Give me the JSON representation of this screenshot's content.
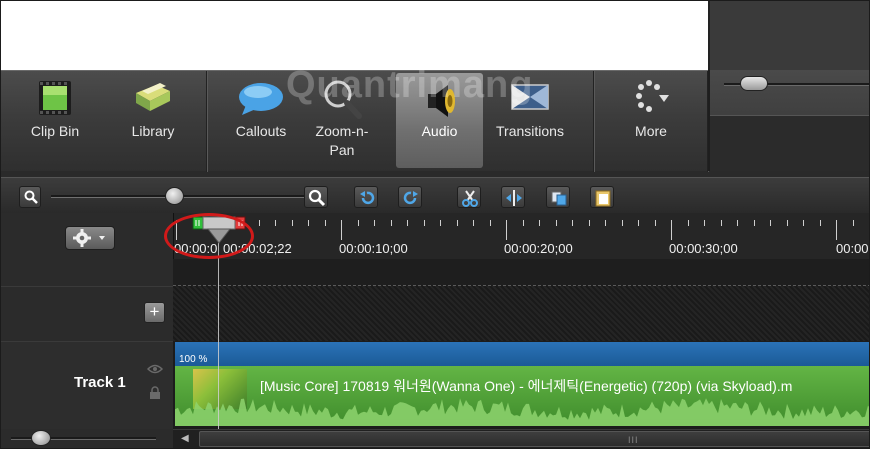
{
  "toolbar": {
    "tools": [
      {
        "label": "Clip Bin",
        "icon": "clip-bin-icon"
      },
      {
        "label": "Library",
        "icon": "library-icon"
      },
      {
        "label": "Callouts",
        "icon": "callouts-icon"
      },
      {
        "label": "Zoom-n-Pan",
        "icon": "zoom-n-pan-icon"
      },
      {
        "label": "Audio",
        "icon": "audio-icon",
        "active": true
      },
      {
        "label": "Transitions",
        "icon": "transitions-icon"
      },
      {
        "label": "More",
        "icon": "more-icon"
      }
    ]
  },
  "watermark": "Quantrimang",
  "timeline": {
    "current_time": "00:00:02;22",
    "ruler_start": "00:00:0",
    "ruler_labels": [
      "00:00:10;00",
      "00:00:20;00",
      "00:00:30;00",
      "00:00"
    ],
    "tracks": [
      {
        "name": "Track 1",
        "clip": {
          "volume": "100 %",
          "title": "[Music Core] 170819 워너원(Wanna One) - 에너제틱(Energetic) (720p) (via Skyload).m"
        }
      }
    ],
    "add_track_symbol": "+",
    "scroll_grip": "III"
  },
  "colors": {
    "accent_blue": "#2b73b8",
    "clip_green": "#4fa33a",
    "highlight_red": "#d11a1a"
  }
}
